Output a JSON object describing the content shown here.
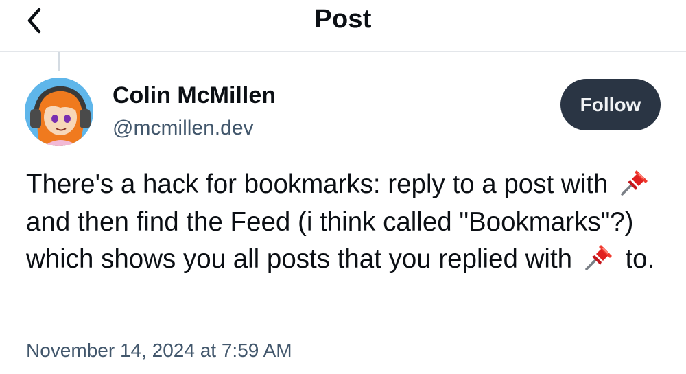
{
  "header": {
    "title": "Post",
    "back_icon": "chevron-left-icon"
  },
  "author": {
    "name": "Colin McMillen",
    "handle": "@mcmillen.dev",
    "avatar_icon": "avatar-image"
  },
  "follow_button": {
    "label": "Follow"
  },
  "post": {
    "segments": [
      "There's a hack for bookmarks: reply to a post with",
      "and then find the Feed (i think called \"Bookmarks\"?) which shows you all posts that you replied with",
      "to."
    ],
    "emoji": "pushpin-emoji-icon",
    "timestamp": "November 14, 2024 at 7:59 AM"
  },
  "colors": {
    "follow_bg": "#2a3544",
    "secondary_text": "#42576c",
    "divider": "#e3e6ea"
  }
}
